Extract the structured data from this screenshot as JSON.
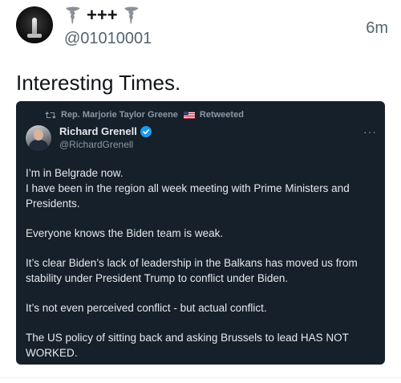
{
  "post": {
    "display_name": "+++",
    "handle": "@01010001",
    "time": "6m",
    "text": "Interesting Times."
  },
  "embedded": {
    "retweeted_by": "Rep. Marjorie Taylor Greene",
    "retweeted_label": "Retweeted",
    "author_name": "Richard Grenell",
    "author_handle": "@RichardGrenell",
    "more_label": "···",
    "paragraphs": [
      [
        "I’m in Belgrade now.",
        "I have been in the region all week meeting with Prime Ministers and",
        "Presidents."
      ],
      [
        "Everyone knows the Biden team is weak."
      ],
      [
        "It’s clear Biden’s lack of leadership in the Balkans has moved us from",
        "stability under President Trump to conflict under Biden."
      ],
      [
        "It’s not even perceived conflict - but actual conflict."
      ],
      [
        "The US policy of sitting back and asking Brussels to lead HAS NOT",
        "WORKED."
      ]
    ]
  },
  "colors": {
    "embed_background": "#15202b",
    "verified_blue": "#1d9bf0",
    "secondary_text": "#536471"
  },
  "icons": {
    "name_left": "tornado-icon",
    "name_right": "tornado-icon",
    "retweet": "retweet-icon",
    "verified": "verified-badge-icon",
    "more": "more-icon"
  }
}
